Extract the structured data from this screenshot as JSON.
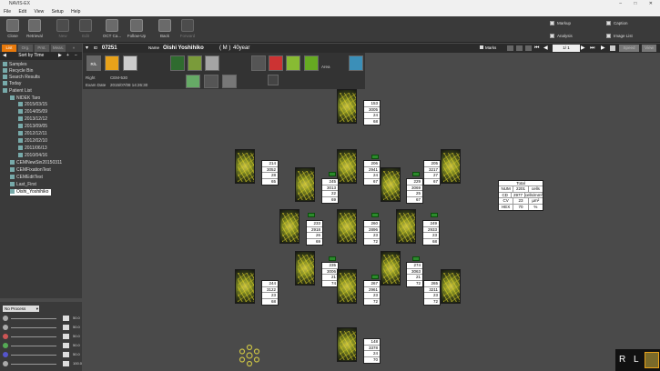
{
  "window": {
    "title": "NAVIS-EX"
  },
  "menu": [
    "File",
    "Edit",
    "View",
    "Setup",
    "Help"
  ],
  "toolbar": {
    "buttons": [
      {
        "label": "Close",
        "icon": "close-icon",
        "enabled": true
      },
      {
        "label": "Retrieval",
        "icon": "retrieve-icon",
        "enabled": true
      },
      {
        "label": "New",
        "icon": "new-icon",
        "enabled": false
      },
      {
        "label": "Edit",
        "icon": "edit-icon",
        "enabled": false
      },
      {
        "label": "OCT Ca...",
        "icon": "oct-icon",
        "enabled": true
      },
      {
        "label": "Follow-Up",
        "icon": "followup-icon",
        "enabled": true
      },
      {
        "label": "Back",
        "icon": "back-icon",
        "enabled": true
      },
      {
        "label": "Forward",
        "icon": "forward-icon",
        "enabled": false
      }
    ],
    "checks": [
      {
        "label": "Markup",
        "checked": false
      },
      {
        "label": "Caption",
        "checked": false
      },
      {
        "label": "Analysis",
        "checked": false
      },
      {
        "label": "Image List",
        "checked": false
      }
    ]
  },
  "left": {
    "tabs": [
      "List",
      "Org.",
      "Prst.",
      "Meas."
    ],
    "sort_label": "Sort by Time",
    "tree": [
      {
        "label": "Samples",
        "level": 0
      },
      {
        "label": "Recycle Bin",
        "level": 0
      },
      {
        "label": "Search Results",
        "level": 0
      },
      {
        "label": "Today",
        "level": 0
      },
      {
        "label": "Patient List",
        "level": 0
      },
      {
        "label": "NIDEK Taro",
        "level": 1
      },
      {
        "label": "2015/03/15",
        "level": 2
      },
      {
        "label": "2014/05/09",
        "level": 2
      },
      {
        "label": "2013/12/12",
        "level": 2
      },
      {
        "label": "2013/09/05",
        "level": 2
      },
      {
        "label": "2012/12/11",
        "level": 2
      },
      {
        "label": "2012/02/10",
        "level": 2
      },
      {
        "label": "2011/06/13",
        "level": 2
      },
      {
        "label": "2010/04/16",
        "level": 2
      },
      {
        "label": "CEMNewSin20150311",
        "level": 1
      },
      {
        "label": "CEMFixationTest",
        "level": 1
      },
      {
        "label": "CEMEditTest",
        "level": 1
      },
      {
        "label": "Last_First",
        "level": 1
      },
      {
        "label": "Oishi_Yoshihiko",
        "level": 1,
        "selected": true
      }
    ],
    "process_select": "No Process",
    "sliders": [
      {
        "icon": "brightness-icon",
        "value": "50.0"
      },
      {
        "icon": "contrast-icon",
        "value": "50.0"
      },
      {
        "icon": "red-channel-icon",
        "value": "50.0"
      },
      {
        "icon": "green-channel-icon",
        "value": "50.0"
      },
      {
        "icon": "blue-channel-icon",
        "value": "50.0"
      },
      {
        "icon": "gamma-icon",
        "value": "100.0"
      }
    ]
  },
  "patient": {
    "id_label": "ID",
    "id": "07251",
    "name_label": "Name",
    "name": "Oishi Yoshihiko",
    "sex": "( M )",
    "age": "40year",
    "eye": "Right",
    "device": "CEM-530",
    "exam_date_label": "Exam Date",
    "exam_date": "2015/07/08 14:26:30"
  },
  "view": {
    "mark_label": "Marks",
    "page_label": "1/ 1",
    "speed_label": "Speed",
    "view_label": "View",
    "area_label": "Area",
    "rl_label": "R/L"
  },
  "legend": {
    "title": "Total",
    "rows": [
      {
        "k": "NUM",
        "v": "2201",
        "u": "cells"
      },
      {
        "k": "CD",
        "v": "2977",
        "u": "cells/mm²"
      },
      {
        "k": "CV",
        "v": "23",
        "u": "µm²"
      },
      {
        "k": "HEX",
        "v": "70",
        "u": "%"
      }
    ]
  },
  "cells": [
    {
      "id": "top-center",
      "values": [
        "153",
        "3005",
        "24",
        "68"
      ]
    },
    {
      "id": "left-top",
      "values": [
        "214",
        "3052",
        "28",
        "65"
      ]
    },
    {
      "id": "center-mid",
      "values": [
        "206",
        "2941",
        "24",
        "67"
      ]
    },
    {
      "id": "right-top",
      "values": [
        "205",
        "3217",
        "27",
        "67"
      ]
    },
    {
      "id": "left-mid-upper",
      "values": [
        "245",
        "3013",
        "22",
        "69"
      ]
    },
    {
      "id": "right-mid-upper",
      "values": [
        "229",
        "3069",
        "25",
        "67"
      ]
    },
    {
      "id": "far-left-mid",
      "values": [
        "233",
        "2918",
        "26",
        "69"
      ]
    },
    {
      "id": "center",
      "values": [
        "260",
        "2896",
        "23",
        "72"
      ]
    },
    {
      "id": "far-right-mid",
      "values": [
        "249",
        "2933",
        "23",
        "68"
      ]
    },
    {
      "id": "left-mid-lower",
      "values": [
        "235",
        "3006",
        "21",
        "74"
      ]
    },
    {
      "id": "right-mid-lower",
      "values": [
        "274",
        "3063",
        "21",
        "72"
      ]
    },
    {
      "id": "left-bottom",
      "values": [
        "244",
        "3122",
        "23",
        "68"
      ]
    },
    {
      "id": "center-lower",
      "values": [
        "267",
        "2961",
        "23",
        "72"
      ]
    },
    {
      "id": "right-bottom",
      "values": [
        "265",
        "3211",
        "23",
        "72"
      ]
    },
    {
      "id": "bottom-center",
      "values": [
        "148",
        "3378",
        "24",
        "70"
      ]
    }
  ],
  "corner": {
    "r": "R",
    "l": "L"
  }
}
